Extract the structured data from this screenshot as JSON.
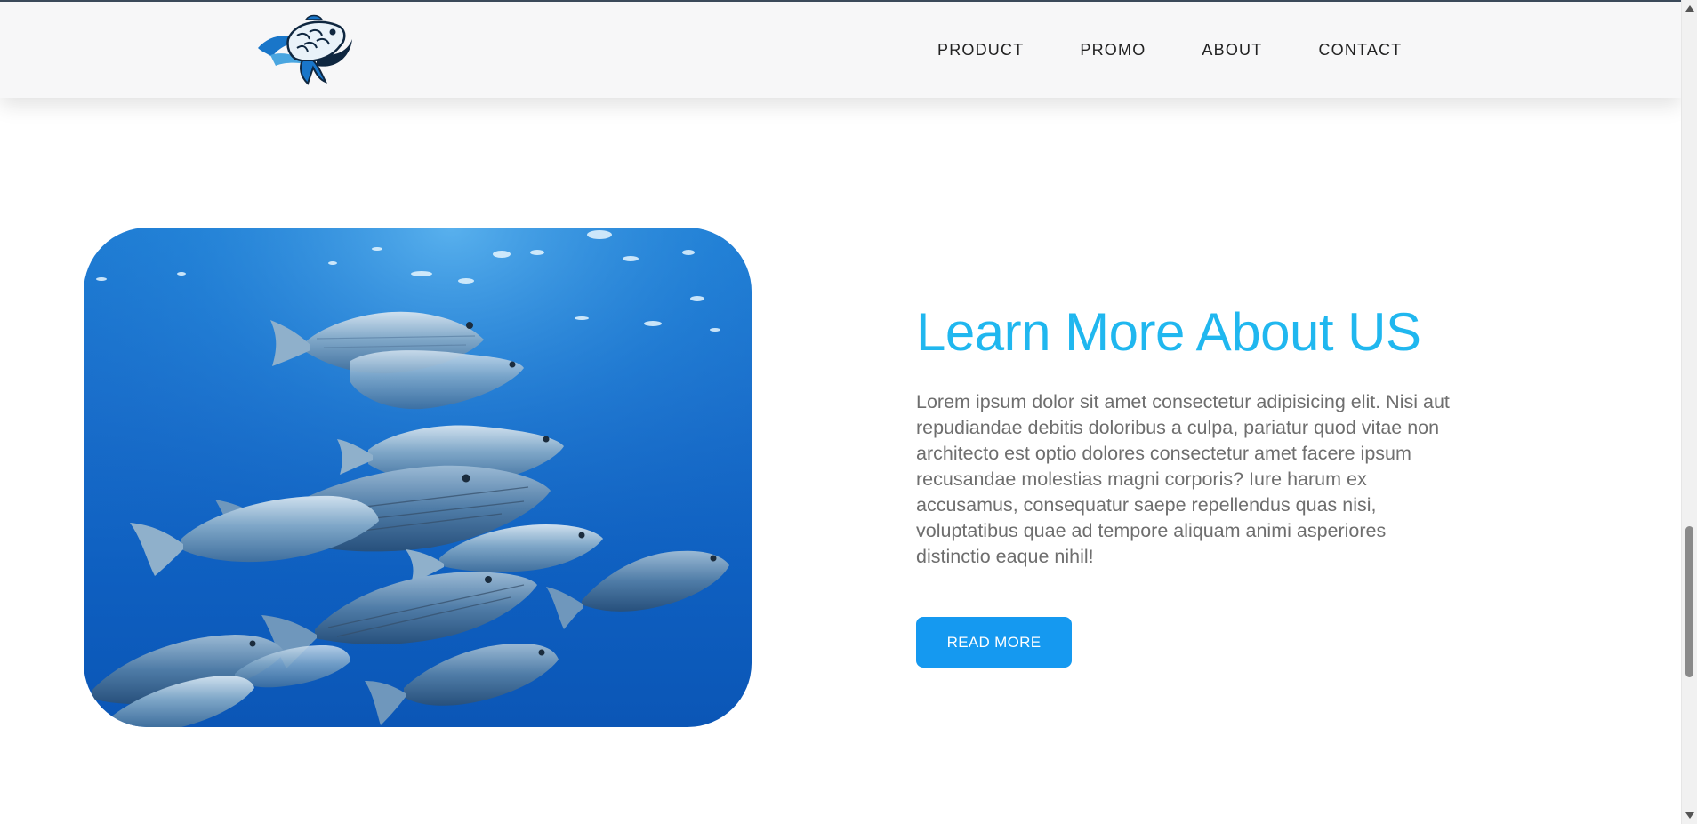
{
  "header": {
    "logo_icon": "fish-logo-icon",
    "nav_items": [
      {
        "label": "PRODUCT"
      },
      {
        "label": "PROMO"
      },
      {
        "label": "ABOUT"
      },
      {
        "label": "CONTACT"
      }
    ]
  },
  "hero": {
    "image_icon": "school-of-fish-photo"
  },
  "about": {
    "title": "Learn More About US",
    "body": "Lorem ipsum dolor sit amet consectetur adipisicing elit. Nisi aut repudiandae debitis doloribus a culpa, pariatur quod vitae non architecto est optio dolores consectetur amet facere ipsum recusandae molestias magni corporis? Iure harum ex accusamus, consequatur saepe repellendus quas nisi, voluptatibus quae ad tempore aliquam animi asperiores distinctio eaque nihil!",
    "button_label": "READ MORE"
  },
  "colors": {
    "accent": "#20b7ef",
    "button": "#1599f0",
    "body_text": "#6e6e6e",
    "navbar_bg": "#f7f7f8",
    "water": "#1a6fcc"
  }
}
